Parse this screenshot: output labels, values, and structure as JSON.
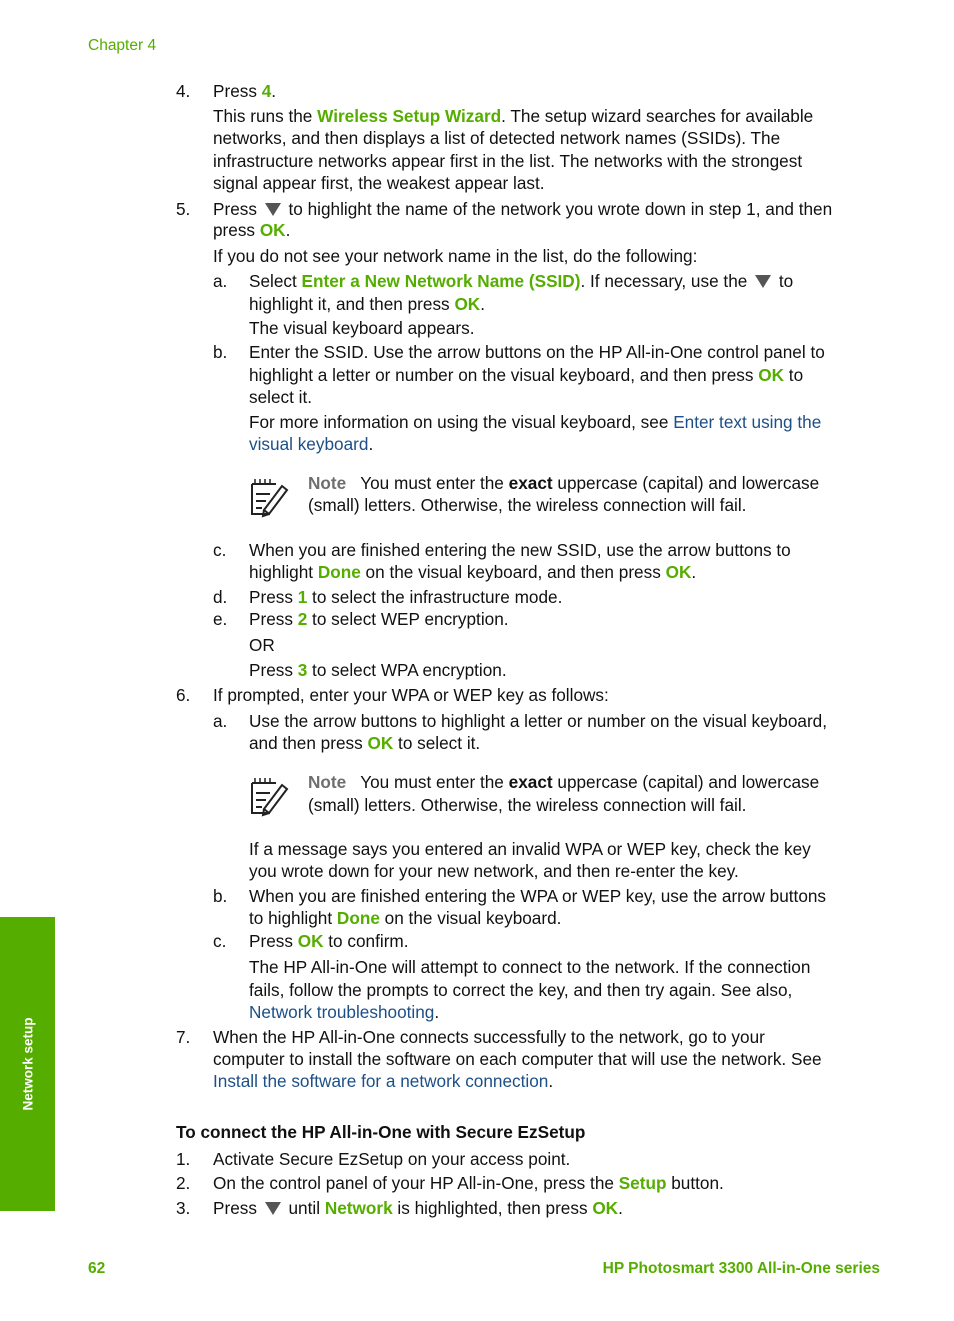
{
  "header": {
    "chapter": "Chapter 4"
  },
  "side_tab": {
    "label": "Network setup"
  },
  "footer": {
    "page_number": "62",
    "product_title": "HP Photosmart 3300 All-in-One series"
  },
  "icons": {
    "down_arrow": "down-arrow-button-icon",
    "note": "note-pad-icon"
  },
  "colors": {
    "accent_green": "#55ad00",
    "link_blue": "#1c4f87",
    "note_label_gray": "#6e6e6e"
  },
  "steps": {
    "s4": {
      "num": "4.",
      "t1": "Press ",
      "k1": "4",
      "t2": ".",
      "p1": "This runs the ",
      "k2": "Wireless Setup Wizard",
      "p2": ". The setup wizard searches for available",
      "l2": "networks, and then displays a list of detected network names (SSIDs). The",
      "l3": "infrastructure networks appear first in the list. The networks with the strongest",
      "l4": "signal appear first, the weakest appear last."
    },
    "s5": {
      "num": "5.",
      "t1": "Press ",
      "t2": " to highlight the name of the network you wrote down in step 1, and then",
      "l2a": "press ",
      "k1": "OK",
      "l2b": ".",
      "p": "If you do not see your network name in the list, do the following:",
      "a": {
        "num": "a.",
        "t1": "Select ",
        "k1": "Enter a New Network Name (SSID)",
        "t2": ". If necessary, use the ",
        "t3": " to",
        "l2a": "highlight it, and then press ",
        "k2": "OK",
        "l2b": ".",
        "p": "The visual keyboard appears."
      },
      "b": {
        "num": "b.",
        "l1": "Enter the SSID. Use the arrow buttons on the HP All-in-One control panel to",
        "l2a": "highlight a letter or number on the visual keyboard, and then press ",
        "k1": "OK",
        "l2b": " to",
        "l3": "select it.",
        "p1": "For more information on using the visual keyboard, see ",
        "link1": "Enter text using the",
        "link2": "visual keyboard",
        "p2": "."
      },
      "note": {
        "label": "Note",
        "t1": "You must enter the ",
        "bold": "exact",
        "t2": " uppercase (capital) and lowercase",
        "l2": "(small) letters. Otherwise, the wireless connection will fail."
      },
      "c": {
        "num": "c.",
        "l1": "When you are finished entering the new SSID, use the arrow buttons to",
        "l2a": "highlight ",
        "k1": "Done",
        "l2b": " on the visual keyboard, and then press ",
        "k2": "OK",
        "l2c": "."
      },
      "d": {
        "num": "d.",
        "t1": "Press ",
        "k1": "1",
        "t2": " to select the infrastructure mode."
      },
      "e": {
        "num": "e.",
        "t1": "Press ",
        "k1": "2",
        "t2": " to select WEP encryption.",
        "or": "OR",
        "t3": "Press ",
        "k2": "3",
        "t4": " to select WPA encryption."
      }
    },
    "s6": {
      "num": "6.",
      "l1": "If prompted, enter your WPA or WEP key as follows:",
      "a": {
        "num": "a.",
        "l1": "Use the arrow buttons to highlight a letter or number on the visual keyboard,",
        "l2a": "and then press ",
        "k1": "OK",
        "l2b": " to select it."
      },
      "note": {
        "label": "Note",
        "t1": "You must enter the ",
        "bold": "exact",
        "t2": " uppercase (capital) and lowercase",
        "l2": "(small) letters. Otherwise, the wireless connection will fail."
      },
      "msg1": "If a message says you entered an invalid WPA or WEP key, check the key",
      "msg2": "you wrote down for your new network, and then re-enter the key.",
      "b": {
        "num": "b.",
        "l1": "When you are finished entering the WPA or WEP key, use the arrow buttons",
        "l2a": "to highlight ",
        "k1": "Done",
        "l2b": " on the visual keyboard."
      },
      "c": {
        "num": "c.",
        "t1": "Press ",
        "k1": "OK",
        "t2": " to confirm.",
        "p1": "The HP All-in-One will attempt to connect to the network. If the connection",
        "p2": "fails, follow the prompts to correct the key, and then try again. See also,",
        "link": "Network troubleshooting",
        "p3": "."
      }
    },
    "s7": {
      "num": "7.",
      "l1": "When the HP All-in-One connects successfully to the network, go to your",
      "l2": "computer to install the software on each computer that will use the network. See",
      "link": "Install the software for a network connection",
      "l3": "."
    }
  },
  "ez": {
    "heading": "To connect the HP All-in-One with Secure EzSetup",
    "s1": {
      "num": "1.",
      "text": "Activate Secure EzSetup on your access point."
    },
    "s2": {
      "num": "2.",
      "t1": "On the control panel of your HP All-in-One, press the ",
      "k1": "Setup",
      "t2": " button."
    },
    "s3": {
      "num": "3.",
      "t1": "Press ",
      "t2": " until ",
      "k1": "Network",
      "t3": " is highlighted, then press ",
      "k2": "OK",
      "t4": "."
    }
  }
}
